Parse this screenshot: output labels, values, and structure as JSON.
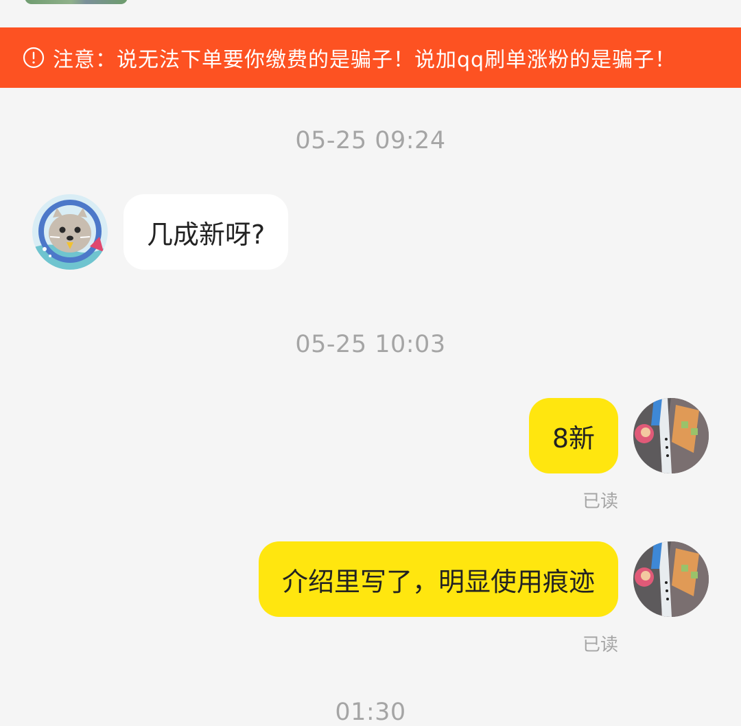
{
  "warning": {
    "text": "注意：说无法下单要你缴费的是骗子！说加qq刷单涨粉的是骗子！",
    "icon": "alert-circle-icon",
    "background": "#fd5222"
  },
  "colors": {
    "page_background": "#f5f5f5",
    "incoming_bubble": "#ffffff",
    "outgoing_bubble": "#ffe60f",
    "timestamp_text": "#a5a5a5"
  },
  "conversation": {
    "timestamp_1": "05-25 09:24",
    "message_1": "几成新呀?",
    "timestamp_2": "05-25 10:03",
    "message_2": "8新",
    "message_2_status": "已读",
    "message_3": "介绍里写了，明显使用痕迹",
    "message_3_status": "已读",
    "timestamp_3": "01:30"
  }
}
